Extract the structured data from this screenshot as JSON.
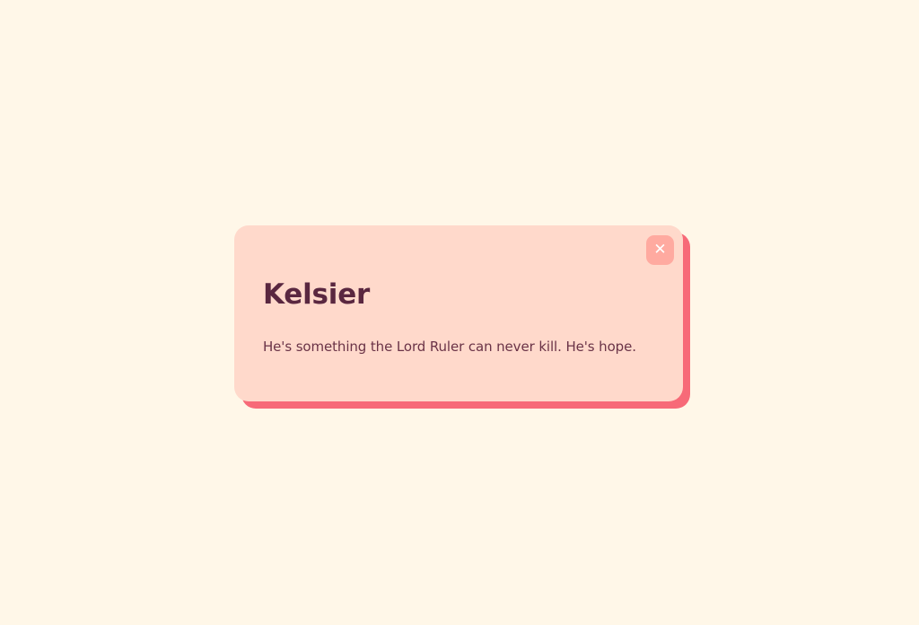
{
  "dialog": {
    "title": "Kelsier",
    "message": "He's something the Lord Ruler can never kill. He's hope.",
    "close_icon": "close-icon"
  },
  "colors": {
    "background": "#fff7e8",
    "card": "#ffd9cb",
    "card_shadow": "#f76a78",
    "title": "#5a2740",
    "text": "#6a3347",
    "close_button": "#ffaaa0"
  }
}
